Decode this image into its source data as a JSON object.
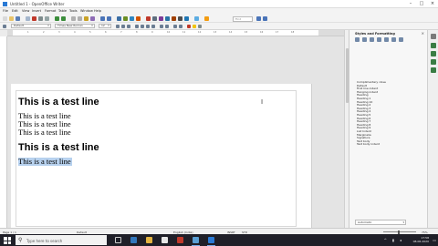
{
  "window": {
    "title": "Untitled 1 - OpenOffice Writer"
  },
  "menu": [
    "File",
    "Edit",
    "View",
    "Insert",
    "Format",
    "Table",
    "Tools",
    "Window",
    "Help"
  ],
  "toolbar": {
    "find_placeholder": "Find",
    "paragraph_style": "Default",
    "font_name": "Times New Roman",
    "font_size": "12"
  },
  "ruler": {
    "marks": [
      "1",
      "2",
      "3",
      "4",
      "5",
      "6",
      "7",
      "8",
      "9",
      "10",
      "11",
      "12",
      "13",
      "14",
      "15",
      "16",
      "17",
      "18"
    ]
  },
  "document": {
    "heading_1": "This is a test line",
    "lines_1": [
      "This is a test line",
      "This is a test line",
      "This is a test line"
    ],
    "heading_2": "This is a test line",
    "selected_line": "This is a test line"
  },
  "sidebar": {
    "title": "Styles and Formatting",
    "styles": [
      "Complimentary close",
      "Default",
      "First line indent",
      "Hanging indent",
      "Heading",
      "Heading 1",
      "Heading 10",
      "Heading 2",
      "Heading 3",
      "Heading 4",
      "Heading 5",
      "Heading 6",
      "Heading 7",
      "Heading 8",
      "Heading 9",
      "List Indent",
      "Marginalia",
      "Signature",
      "Text body",
      "Text body indent"
    ],
    "filter": "Automatic"
  },
  "statusbar": {
    "page": "Page 1 / 1",
    "style": "Default",
    "language": "English (India)",
    "mode": "INSRT",
    "selection": "STD",
    "zoom": "75%"
  },
  "taskbar": {
    "search_placeholder": "Type here to search",
    "time": "17:58",
    "date": "08-06-2020"
  },
  "colors": {
    "selection": "#b7d1ee",
    "taskbar": "#1f1f28",
    "app_accent": "#2a7ad5"
  }
}
